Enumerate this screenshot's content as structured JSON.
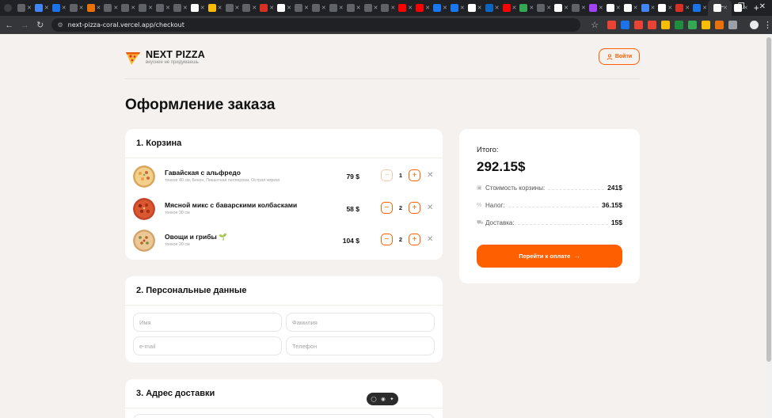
{
  "browser": {
    "url": "next-pizza-coral.vercel.app/checkout",
    "tab_colors": [
      "#5f6368",
      "#4285f4",
      "#1a73e8",
      "#5f6368",
      "#e8710a",
      "#5f6368",
      "#5f6368",
      "#5f6368",
      "#5f6368",
      "#5f6368",
      "#ffffff",
      "#fbbc04",
      "#5f6368",
      "#5f6368",
      "#d93025",
      "#ffffff",
      "#5f6368",
      "#5f6368",
      "#5f6368",
      "#5f6368",
      "#5f6368",
      "#5f6368",
      "#ff0000",
      "#ff0000",
      "#1877f2",
      "#1877f2",
      "#ffffff",
      "#0a66c2",
      "#ff0000",
      "#34a853",
      "#5f6368",
      "#ffffff",
      "#5f6368",
      "#a142f4",
      "#ffffff",
      "#ffffff",
      "#4285f4",
      "#ffffff",
      "#d93025",
      "#1a73e8",
      "#ffffff",
      "#ffffff"
    ],
    "extension_colors": [
      "#ea4335",
      "#1a73e8",
      "#ea4335",
      "#ea4335",
      "#fbbc04",
      "#1e8e3e",
      "#34a853",
      "#fbbc04",
      "#e8710a",
      "#9aa0a6"
    ]
  },
  "header": {
    "brand": "NEXT PIZZA",
    "tagline": "вкуснее не придумаешь",
    "login_label": "Войти"
  },
  "page_title": "Оформление заказа",
  "cart": {
    "title": "1. Корзина",
    "items": [
      {
        "name": "Гавайская с альфредо",
        "desc": "тонкое 40 см, Бекон, Пикантная пепперони, Острая чоризо",
        "price": "79 $",
        "qty": "1"
      },
      {
        "name": "Мясной микс с баварскими колбасками",
        "desc": "тонкое 30 см",
        "price": "58 $",
        "qty": "2"
      },
      {
        "name": "Овощи и грибы 🌱",
        "desc": "тонкое 20 см",
        "price": "104 $",
        "qty": "2"
      }
    ]
  },
  "personal": {
    "title": "2. Персональные данные",
    "first_name_ph": "Имя",
    "last_name_ph": "Фамилия",
    "email_ph": "e-mail",
    "phone_ph": "Телефон"
  },
  "address": {
    "title": "3. Адрес доставки"
  },
  "summary": {
    "total_label": "Итого:",
    "total_value": "292.15$",
    "rows": [
      {
        "icon": "package-icon",
        "label": "Стоимость корзины:",
        "value": "241$"
      },
      {
        "icon": "percent-icon",
        "label": "Налог:",
        "value": "36.15$"
      },
      {
        "icon": "truck-icon",
        "label": "Доставка:",
        "value": "15$"
      }
    ],
    "pay_label": "Перейти к оплате"
  },
  "colors": {
    "accent": "#fe5f00",
    "background": "#f4f1ee"
  }
}
